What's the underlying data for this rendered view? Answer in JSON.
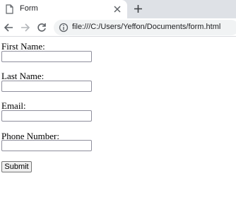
{
  "browser": {
    "tab_title": "Form",
    "url": "file:///C:/Users/Yeffon/Documents/form.html",
    "icons": {
      "tab": "page-icon",
      "close": "close-icon",
      "new_tab": "plus-icon",
      "back": "back-arrow-icon",
      "forward": "forward-arrow-icon",
      "reload": "reload-icon",
      "info": "info-icon"
    }
  },
  "form": {
    "first_name_label": "First Name:",
    "first_name_value": "",
    "last_name_label": "Last Name:",
    "last_name_value": "",
    "email_label": "Email:",
    "email_value": "",
    "phone_label": "Phone Number:",
    "phone_value": "",
    "submit_label": "Submit"
  }
}
